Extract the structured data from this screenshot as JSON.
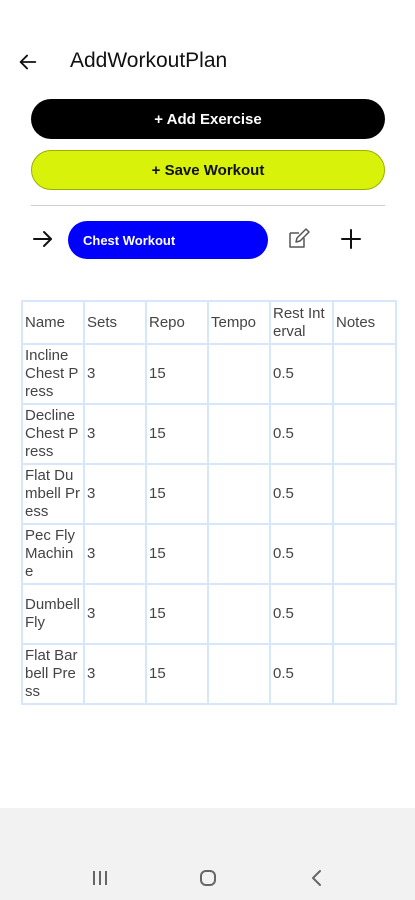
{
  "header": {
    "title": "AddWorkoutPlan",
    "back_icon": "arrow-left-icon"
  },
  "actions": {
    "add_exercise_label": "+ Add Exercise",
    "save_workout_label": "+ Save Workout"
  },
  "plan": {
    "name": "Chest Workout",
    "arrow_icon": "arrow-right-icon",
    "edit_icon": "edit-icon",
    "add_icon": "plus-icon"
  },
  "table": {
    "headers": [
      "Name",
      "Sets",
      "Repo",
      "Tempo",
      "Rest Interval",
      "Notes"
    ],
    "rows": [
      [
        "Incline Chest Press",
        "3",
        "15",
        "",
        "0.5",
        ""
      ],
      [
        "Decline Chest Press",
        "3",
        "15",
        "",
        "0.5",
        ""
      ],
      [
        "Flat Dumbell Press",
        "3",
        "15",
        "",
        "0.5",
        ""
      ],
      [
        "Pec Fly Machine",
        "3",
        "15",
        "",
        "0.5",
        ""
      ],
      [
        "Dumbell Fly",
        "3",
        "15",
        "",
        "0.5",
        ""
      ],
      [
        "Flat Barbell Press",
        "3",
        "15",
        "",
        "0.5",
        ""
      ]
    ]
  },
  "colors": {
    "primary_blue": "#0000ff",
    "save_green": "#d9f20a",
    "black": "#000000",
    "table_border": "#d6e6fb"
  },
  "system_nav": {
    "recents_icon": "recents-icon",
    "home_icon": "home-icon",
    "back_icon": "back-chevron-icon"
  }
}
